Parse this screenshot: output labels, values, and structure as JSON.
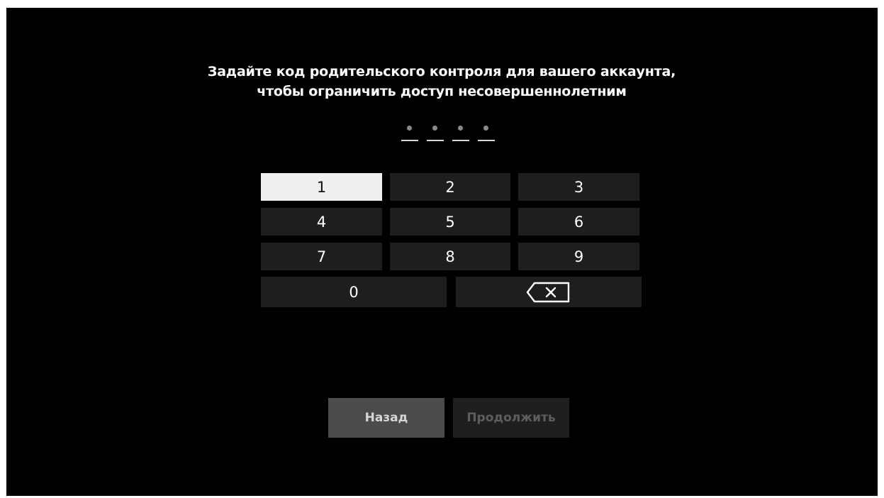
{
  "prompt": {
    "line1": "Задайте код родительского контроля для вашего аккаунта,",
    "line2": "чтобы ограничить доступ несовершеннолетним"
  },
  "pin": {
    "length": 4,
    "filled": 0,
    "dot_color": "#8a8a8a"
  },
  "keypad": {
    "keys": [
      "1",
      "2",
      "3",
      "4",
      "5",
      "6",
      "7",
      "8",
      "9",
      "0"
    ],
    "focused_key": "1",
    "backspace_icon": "backspace-icon"
  },
  "actions": {
    "back_label": "Назад",
    "continue_label": "Продолжить"
  },
  "colors": {
    "background": "#000000",
    "key_bg": "#1e1e1e",
    "focused_key_bg": "#efefef",
    "back_bg": "#4b4b4b",
    "continue_disabled_bg": "#1f1f1f"
  }
}
